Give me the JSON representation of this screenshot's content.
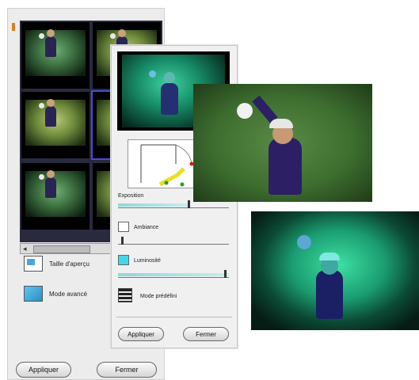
{
  "back_panel": {
    "options": [
      {
        "label": "Taille d'aperçu",
        "icon": "preview-size-icon"
      },
      {
        "label": "Mode avancé",
        "icon": "advanced-mode-icon"
      }
    ],
    "apply_label": "Appliquer",
    "close_label": "Fermer"
  },
  "front_panel": {
    "exposition_label": "Exposition",
    "ambiance_label": "Ambiance",
    "luminosite_label": "Luminosité",
    "mode_label": "Mode prédéfini",
    "apply_label": "Appliquer",
    "close_label": "Fermer"
  },
  "colors": {
    "accent_cyan": "#3fd8e8",
    "panel_bg": "#ececec"
  }
}
